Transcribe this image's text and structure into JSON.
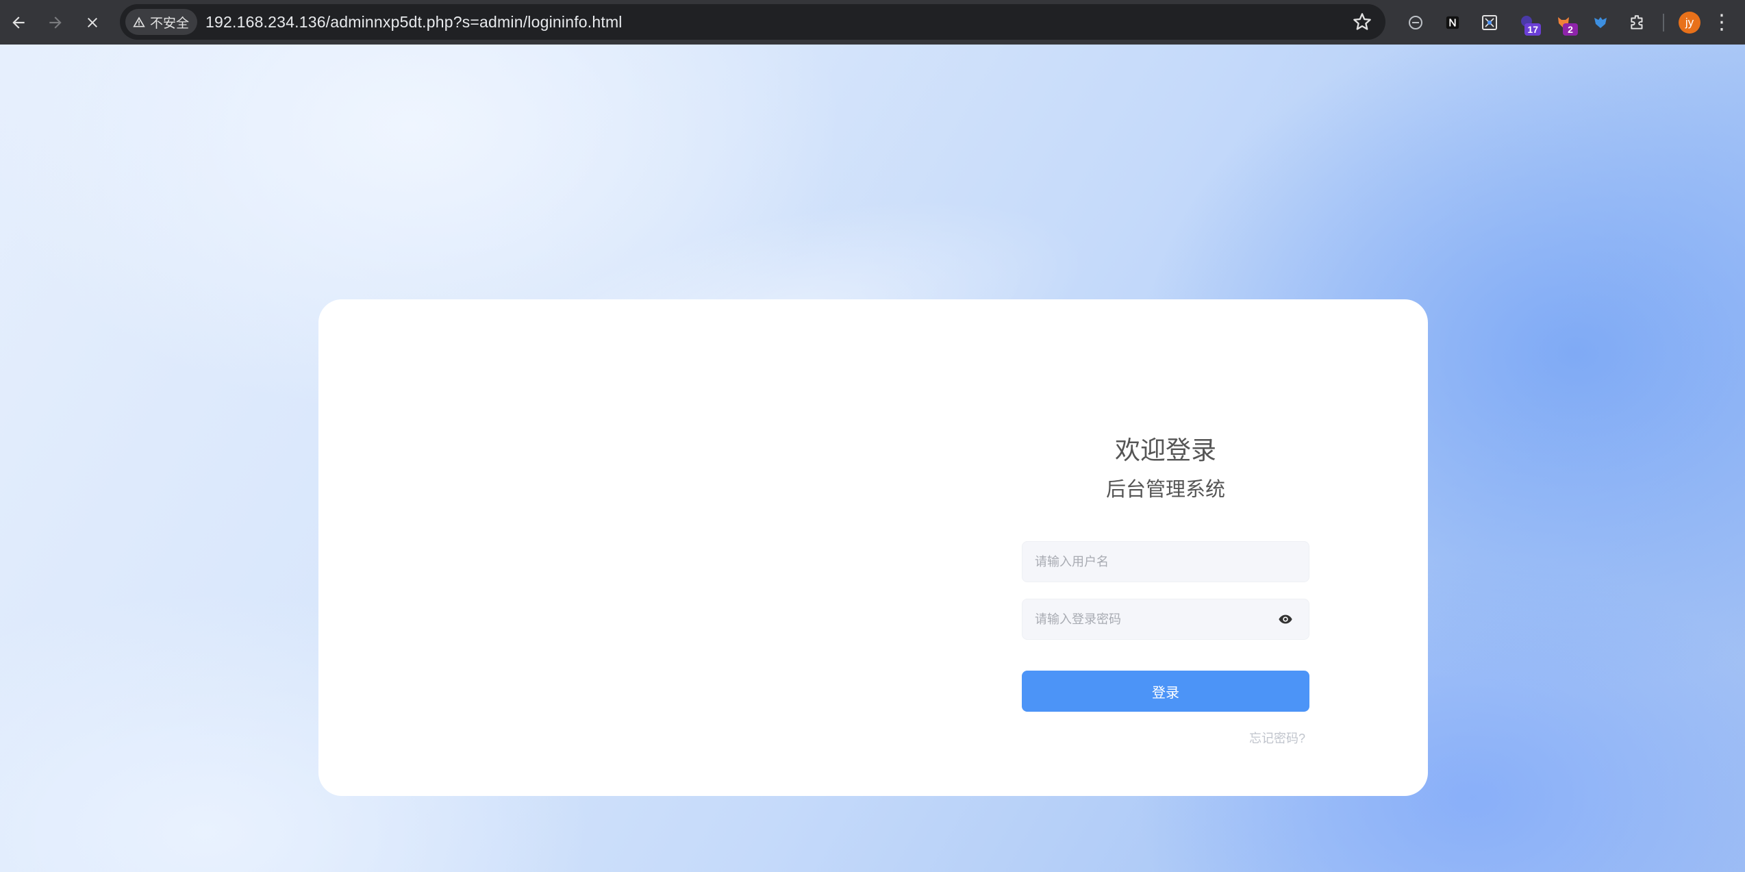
{
  "browser": {
    "security_label": "不安全",
    "url": "192.168.234.136/adminnxp5dt.php?s=admin/logininfo.html",
    "extensions": [
      {
        "name": "minus-circle",
        "badge": ""
      },
      {
        "name": "notion",
        "badge": ""
      },
      {
        "name": "grid-tool",
        "badge": ""
      },
      {
        "name": "purple-ext",
        "badge": "17"
      },
      {
        "name": "fox-ext",
        "badge": "2"
      },
      {
        "name": "blue-bird",
        "badge": ""
      },
      {
        "name": "puzzle",
        "badge": ""
      }
    ],
    "profile_initials": "jy"
  },
  "login": {
    "title": "欢迎登录",
    "subtitle": "后台管理系统",
    "username_placeholder": "请输入用户名",
    "password_placeholder": "请输入登录密码",
    "submit_label": "登录",
    "forgot_label": "忘记密码?"
  },
  "colors": {
    "primary_button": "#4c94f7",
    "chrome_bg": "#35363a",
    "omnibox_bg": "#202124"
  }
}
